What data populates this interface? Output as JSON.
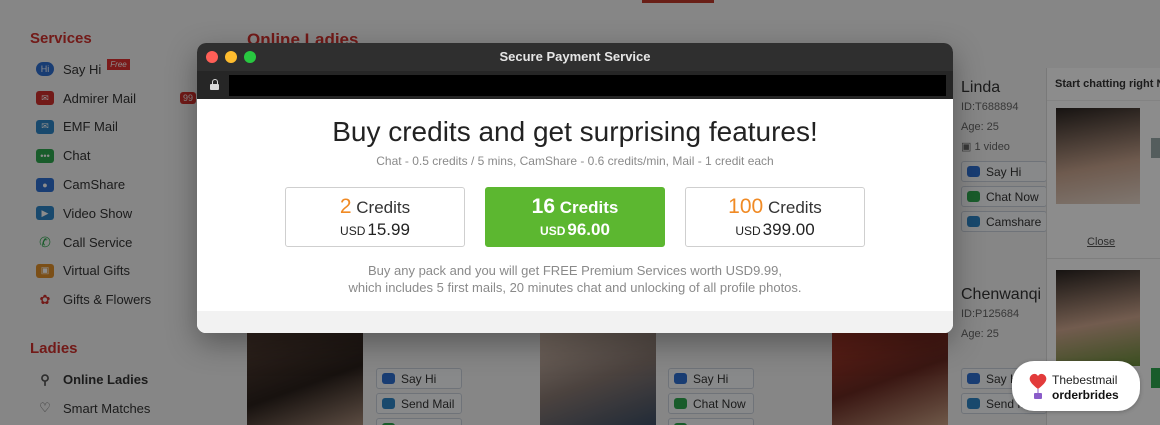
{
  "sidebar": {
    "services_heading": "Services",
    "services": [
      {
        "label": "Say Hi",
        "badge": "Free",
        "icon": "say-hi-icon",
        "color": "#2f6fd1"
      },
      {
        "label": "Admirer Mail",
        "badge": "99",
        "icon": "mail-icon",
        "color": "#d0312d"
      },
      {
        "label": "EMF Mail",
        "icon": "envelope-icon",
        "color": "#2f86c6"
      },
      {
        "label": "Chat",
        "icon": "chat-bubble-icon",
        "color": "#2fa84f"
      },
      {
        "label": "CamShare",
        "icon": "camera-icon",
        "color": "#2f6fd1"
      },
      {
        "label": "Video Show",
        "icon": "video-icon",
        "color": "#2f86c6"
      },
      {
        "label": "Call Service",
        "icon": "phone-icon",
        "color": "#2fa84f"
      },
      {
        "label": "Virtual Gifts",
        "icon": "gift-icon",
        "color": "#e0902a"
      },
      {
        "label": "Gifts & Flowers",
        "icon": "flower-icon",
        "color": "#d0312d"
      }
    ],
    "ladies_heading": "Ladies",
    "ladies": [
      {
        "label": "Online Ladies",
        "icon": "person-icon"
      },
      {
        "label": "Smart Matches",
        "icon": "heart-outline-icon"
      }
    ]
  },
  "main": {
    "title": "Online Ladies",
    "profiles": [
      {
        "name": "Linda",
        "id": "ID:T688894",
        "age": "Age: 25",
        "video": "1 video"
      },
      {
        "name": "Chenwanqi",
        "id": "ID:P125684",
        "age": "Age: 25"
      }
    ],
    "buttons": {
      "say_hi": "Say Hi",
      "chat_now": "Chat Now",
      "camshare": "Camshare",
      "send_mail": "Send Mail"
    }
  },
  "chat_panel": {
    "title": "Start chatting right N",
    "close": "Close"
  },
  "modal": {
    "window_title": "Secure Payment Service",
    "headline": "Buy credits and get surprising features!",
    "subline": "Chat - 0.5 credits / 5 mins, CamShare - 0.6 credits/min, Mail - 1 credit each",
    "packs": [
      {
        "credits": "2",
        "credits_label": "Credits",
        "currency": "USD",
        "price": "15.99",
        "featured": false
      },
      {
        "credits": "16",
        "credits_label": "Credits",
        "currency": "USD",
        "price": "96.00",
        "featured": true
      },
      {
        "credits": "100",
        "credits_label": "Credits",
        "currency": "USD",
        "price": "399.00",
        "featured": false
      }
    ],
    "note_line1": "Buy any pack and you will get FREE Premium Services worth USD9.99,",
    "note_line2": "which includes 5 first mails, 20 minutes chat and unlocking of all profile photos."
  },
  "watermark": {
    "line1": "Thebestmail",
    "line2": "orderbrides"
  },
  "colors": {
    "brand_red": "#d0312d",
    "featured_green": "#5cb730",
    "credit_orange": "#f08a24"
  }
}
